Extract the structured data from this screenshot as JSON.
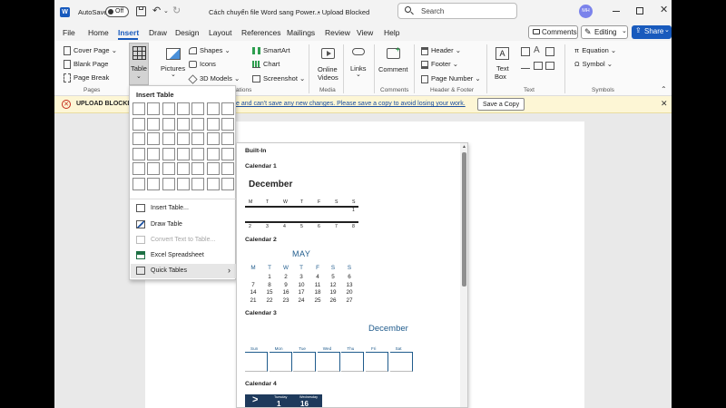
{
  "titlebar": {
    "app_logo": "W",
    "autosave_label": "AutoSave",
    "autosave_state": "Off",
    "doc_title": "Cách chuyển file Word sang Power...",
    "status": "• Upload Blocked",
    "search_placeholder": "Search",
    "avatar_initials": "MH"
  },
  "tabs": [
    "File",
    "Home",
    "Insert",
    "Draw",
    "Design",
    "Layout",
    "References",
    "Mailings",
    "Review",
    "View",
    "Help"
  ],
  "active_tab": "Insert",
  "tab_actions": {
    "comments": "Comments",
    "editing": "Editing",
    "share": "Share"
  },
  "ribbon": {
    "pages": {
      "cover_page": "Cover Page",
      "blank_page": "Blank Page",
      "page_break": "Page Break",
      "group": "Pages"
    },
    "table": {
      "label": "Table"
    },
    "illustrations": {
      "pictures": "Pictures",
      "shapes": "Shapes",
      "icons": "Icons",
      "models": "3D Models",
      "smartart": "SmartArt",
      "chart": "Chart",
      "screenshot": "Screenshot",
      "group_partial": "ations"
    },
    "media": {
      "online": "Online",
      "videos": "Videos",
      "group": "Media"
    },
    "links": {
      "label": "Links"
    },
    "comments": {
      "label": "Comment",
      "group": "Comments"
    },
    "header_footer": {
      "header": "Header",
      "footer": "Footer",
      "page_number": "Page Number",
      "group": "Header & Footer"
    },
    "text": {
      "text_box_1": "Text",
      "text_box_2": "Box",
      "group": "Text"
    },
    "symbols": {
      "equation": "Equation",
      "symbol": "Symbol",
      "group": "Symbols"
    }
  },
  "banner": {
    "title": "UPLOAD BLOCKED",
    "message": "e and can't save any new changes. Please save a copy to avoid losing your work.",
    "button": "Save a Copy"
  },
  "table_menu": {
    "title": "Insert Table",
    "items": [
      {
        "label": "Insert Table...",
        "enabled": true
      },
      {
        "label": "Draw Table",
        "enabled": true
      },
      {
        "label": "Convert Text to Table...",
        "enabled": false
      },
      {
        "label": "Excel Spreadsheet",
        "enabled": true
      },
      {
        "label": "Quick Tables",
        "enabled": true
      }
    ]
  },
  "gallery": {
    "section": "Built-In",
    "cal1": {
      "name": "Calendar 1",
      "month": "December",
      "days": [
        "M",
        "T",
        "W",
        "T",
        "F",
        "S",
        "S"
      ],
      "row1": [
        "",
        "",
        "",
        "",
        "",
        "",
        "1"
      ],
      "row2": [
        "2",
        "3",
        "4",
        "5",
        "6",
        "7",
        "8"
      ]
    },
    "cal2": {
      "name": "Calendar 2",
      "month": "MAY",
      "days": [
        "M",
        "T",
        "W",
        "T",
        "F",
        "S",
        "S"
      ],
      "weeks": [
        [
          "",
          "1",
          "2",
          "3",
          "4",
          "5",
          "6"
        ],
        [
          "7",
          "8",
          "9",
          "10",
          "11",
          "12",
          "13"
        ],
        [
          "14",
          "15",
          "16",
          "17",
          "18",
          "19",
          "20"
        ],
        [
          "21",
          "22",
          "23",
          "24",
          "25",
          "26",
          "27"
        ]
      ]
    },
    "cal3": {
      "name": "Calendar 3",
      "month": "December",
      "days": [
        "Sun",
        "Mon",
        "Tue",
        "Wed",
        "Thu",
        "Fri",
        "Sat"
      ]
    },
    "cal4": {
      "name": "Calendar 4",
      "days": [
        "Tuesday",
        "Wednesday"
      ],
      "numbers": [
        "1",
        "16"
      ]
    }
  }
}
